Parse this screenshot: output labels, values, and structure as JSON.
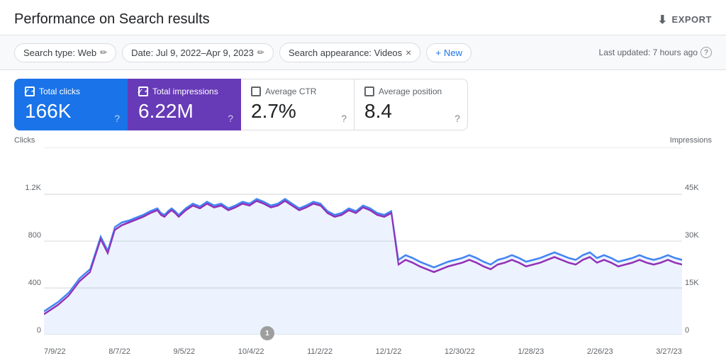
{
  "header": {
    "title": "Performance on Search results",
    "export_label": "EXPORT"
  },
  "filters": {
    "search_type": "Search type: Web",
    "date_range": "Date: Jul 9, 2022–Apr 9, 2023",
    "search_appearance": "Search appearance: Videos",
    "add_label": "New",
    "last_updated": "Last updated: 7 hours ago"
  },
  "metrics": [
    {
      "id": "total-clicks",
      "label": "Total clicks",
      "value": "166K",
      "active": true,
      "style": "blue",
      "checked": true
    },
    {
      "id": "total-impressions",
      "label": "Total impressions",
      "value": "6.22M",
      "active": true,
      "style": "purple",
      "checked": true
    },
    {
      "id": "average-ctr",
      "label": "Average CTR",
      "value": "2.7%",
      "active": false,
      "style": "inactive",
      "checked": false
    },
    {
      "id": "average-position",
      "label": "Average position",
      "value": "8.4",
      "active": false,
      "style": "inactive",
      "checked": false
    }
  ],
  "chart": {
    "y_left_label": "Clicks",
    "y_right_label": "Impressions",
    "y_left_values": [
      "1.2K",
      "800",
      "400",
      "0"
    ],
    "y_right_values": [
      "45K",
      "30K",
      "15K",
      "0"
    ],
    "x_labels": [
      "7/9/22",
      "8/7/22",
      "9/5/22",
      "10/4/22",
      "11/2/22",
      "12/1/22",
      "12/30/22",
      "1/28/23",
      "2/26/23",
      "3/27/23"
    ],
    "annotation": "1",
    "annotation_position_percent": 32
  },
  "icons": {
    "export": "⬇",
    "edit": "✏",
    "close": "×",
    "add": "+",
    "help": "?"
  }
}
